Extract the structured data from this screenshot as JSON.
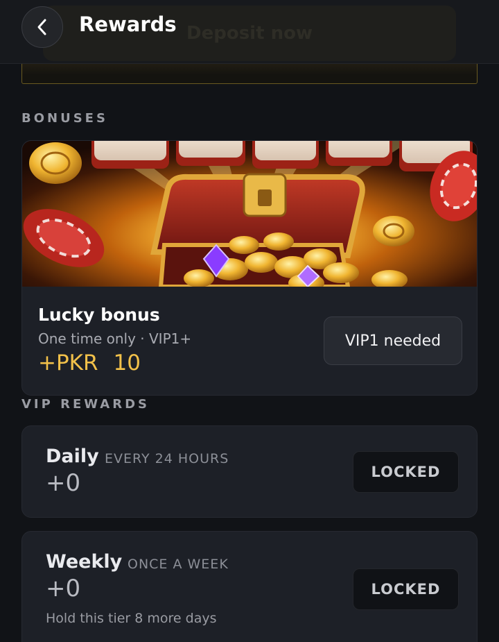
{
  "header": {
    "title": "Rewards",
    "background_button_label": "Deposit now"
  },
  "sections": {
    "bonuses_label": "BONUSES",
    "vip_rewards_label": "VIP REWARDS"
  },
  "bonus": {
    "title": "Lucky bonus",
    "subtitle": "One time only · VIP1+",
    "currency": "+PKR",
    "amount": "10",
    "action_label": "VIP1 needed"
  },
  "rewards": [
    {
      "name": "Daily",
      "period": "EVERY 24 HOURS",
      "value": "+0",
      "status_label": "LOCKED"
    },
    {
      "name": "Weekly",
      "period": "ONCE A WEEK",
      "value": "+0",
      "note": "Hold this tier 8 more days",
      "status_label": "LOCKED"
    }
  ],
  "colors": {
    "accent_gold": "#f2c14a",
    "background": "#111317",
    "card": "#1d2027"
  },
  "icons": {
    "back": "chevron-left-icon"
  }
}
